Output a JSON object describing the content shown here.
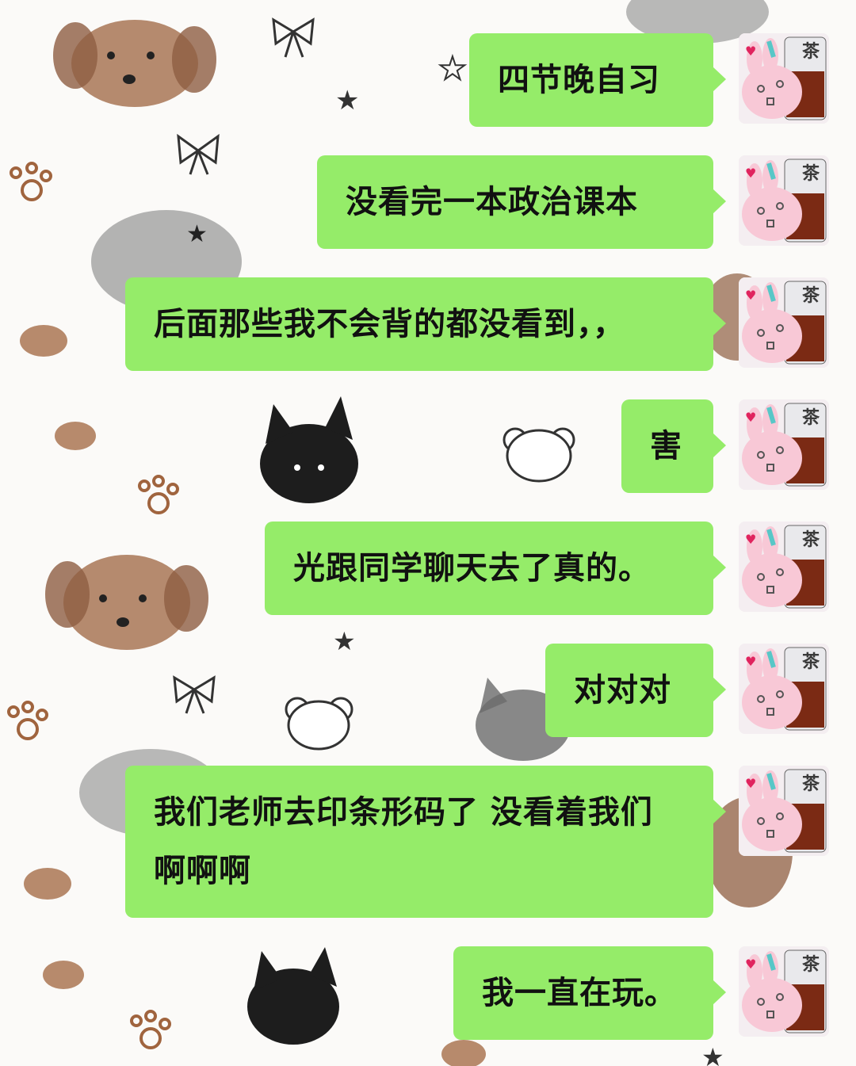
{
  "chat": {
    "messages": [
      {
        "sender": "self",
        "text": "四节晚自习"
      },
      {
        "sender": "self",
        "text": "没看完一本政治课本"
      },
      {
        "sender": "self",
        "text": "后面那些我不会背的都没看到，，"
      },
      {
        "sender": "self",
        "text": "害"
      },
      {
        "sender": "self",
        "text": "光跟同学聊天去了真的。"
      },
      {
        "sender": "self",
        "text": "对对对"
      },
      {
        "sender": "self",
        "text": "我们老师去印条形码了 没看着我们啊啊啊"
      },
      {
        "sender": "self",
        "text": "我一直在玩。"
      }
    ],
    "avatar": {
      "caption": "茶",
      "icon": "bunny-milk-tea-avatar-icon"
    }
  },
  "colors": {
    "bubble": "#95ec69",
    "text": "#111111",
    "background": "#fbfaf8"
  }
}
